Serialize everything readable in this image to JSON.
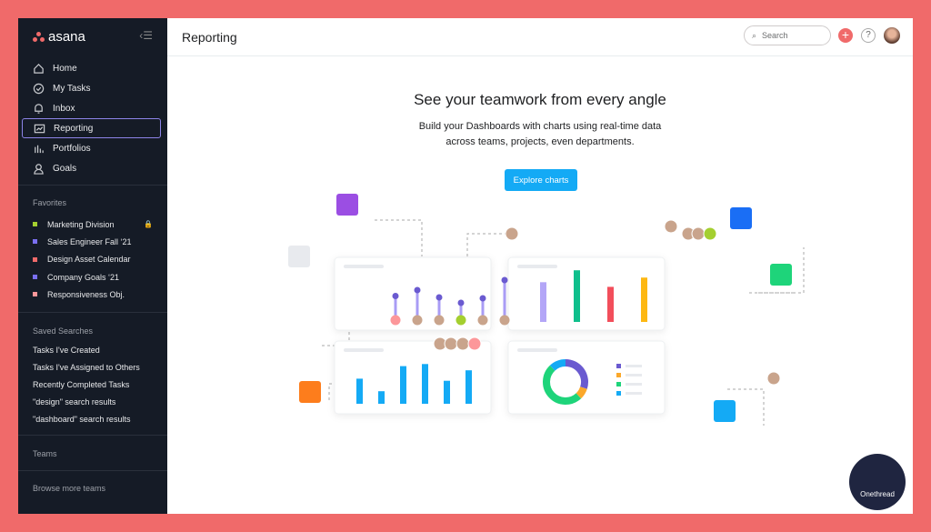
{
  "sidebar": {
    "logo": "asana",
    "nav": [
      {
        "label": "Home",
        "icon": "home-icon"
      },
      {
        "label": "My Tasks",
        "icon": "check-circle-icon"
      },
      {
        "label": "Inbox",
        "icon": "bell-icon"
      },
      {
        "label": "Reporting",
        "icon": "chart-icon",
        "selected": true
      },
      {
        "label": "Portfolios",
        "icon": "bars-icon"
      },
      {
        "label": "Goals",
        "icon": "person-icon"
      }
    ],
    "favorites_title": "Favorites",
    "favorites": [
      {
        "label": "Marketing Division",
        "color": "#a4cf30",
        "locked": true
      },
      {
        "label": "Sales Engineer Fall ‘21",
        "color": "#7a6ff0"
      },
      {
        "label": "Design Asset Calendar",
        "color": "#f06a6a"
      },
      {
        "label": "Company Goals ‘21",
        "color": "#7a6ff0"
      },
      {
        "label": "Responsiveness Obj.",
        "color": "#fc979a"
      }
    ],
    "saved_title": "Saved Searches",
    "saved": [
      "Tasks I've Created",
      "Tasks I've Assigned to Others",
      "Recently Completed Tasks",
      "\"design\" search results",
      "\"dashboard\" search results"
    ],
    "teams_title": "Teams",
    "browse": "Browse more teams"
  },
  "header": {
    "title": "Reporting",
    "search_placeholder": "Search"
  },
  "hero": {
    "title": "See your teamwork from every angle",
    "line1": "Build your Dashboards with charts using real-time data",
    "line2": "across teams, projects, even departments.",
    "button": "Explore charts"
  },
  "illustration": {
    "lollipop": [
      0.55,
      0.68,
      0.52,
      0.4,
      0.5,
      0.9
    ],
    "bars_color": [
      "#b3a6f7",
      "#0fbf8c",
      "#f24e5b",
      "#fdb813"
    ],
    "bars": [
      0.6,
      0.78,
      0.53,
      0.67
    ],
    "blue_bars": [
      0.6,
      0.3,
      0.9,
      0.95,
      0.55,
      0.8
    ],
    "donut": [
      {
        "color": "#6a5ad0",
        "value": 0.3
      },
      {
        "color": "#fba82b",
        "value": 0.08
      },
      {
        "color": "#1ed47a",
        "value": 0.5
      },
      {
        "color": "#14aaf5",
        "value": 0.12
      }
    ]
  },
  "watermark": "Onethread"
}
